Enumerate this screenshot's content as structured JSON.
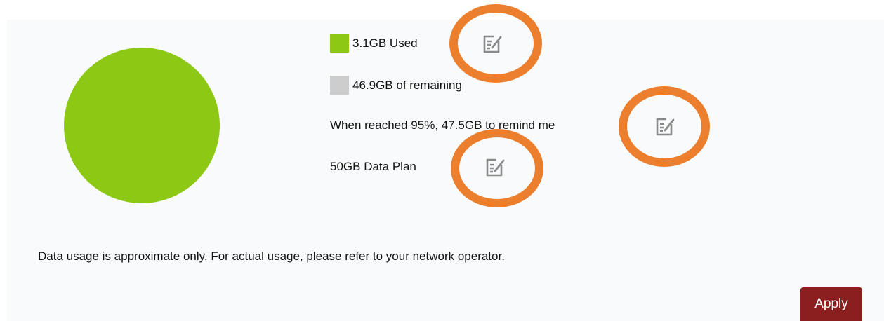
{
  "usage": {
    "used_label": "3.1GB Used",
    "remaining_label": "46.9GB of remaining",
    "remind_label": "When reached 95%, 47.5GB to remind me",
    "plan_label": "50GB Data Plan",
    "used_gb": 3.1,
    "remaining_gb": 46.9,
    "plan_gb": 50,
    "colors": {
      "used": "#8cc814",
      "remaining": "#cccccc"
    }
  },
  "icons": {
    "edit": "edit-icon"
  },
  "disclaimer": "Data usage is approximate only. For actual usage, please refer to your network operator.",
  "actions": {
    "apply_label": "Apply"
  },
  "annotation": {
    "ring_color": "#ec7f2e"
  }
}
